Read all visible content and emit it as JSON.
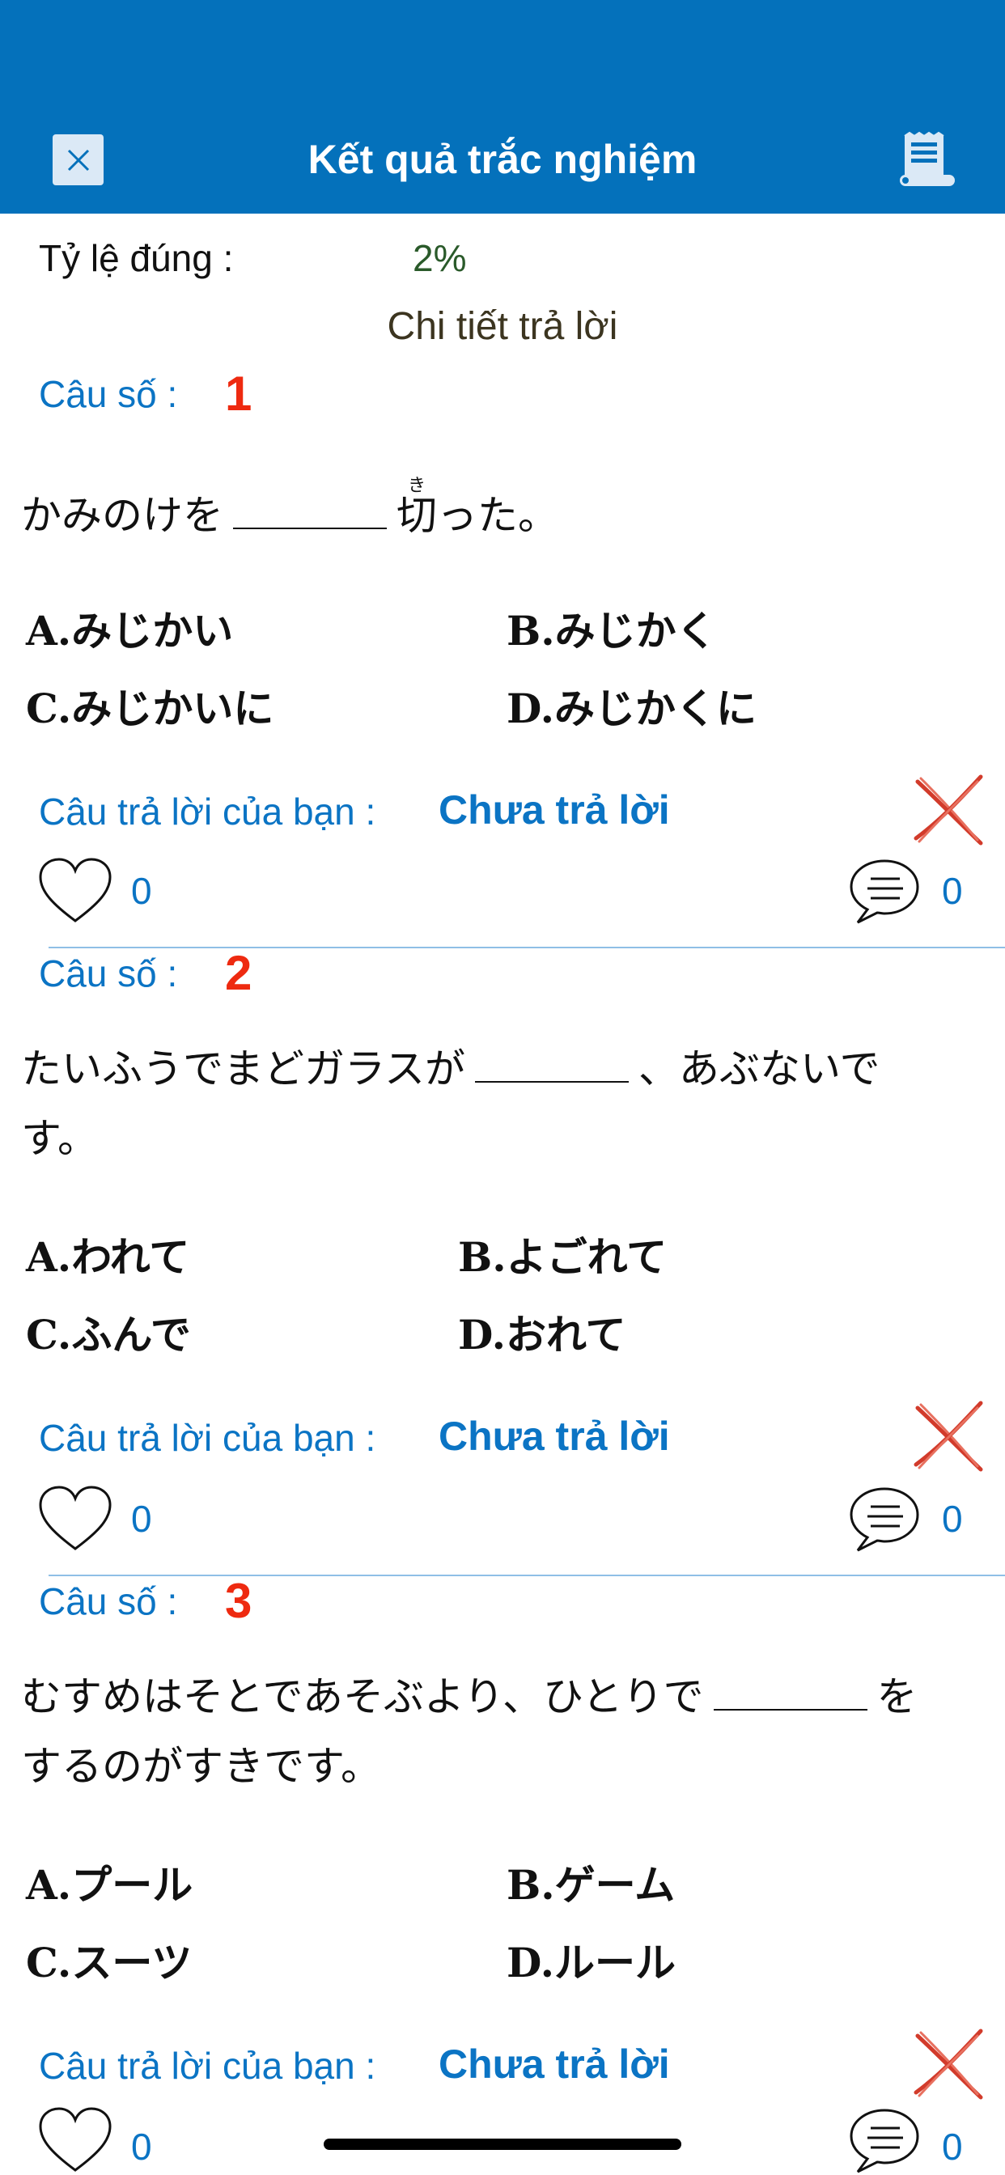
{
  "header": {
    "title": "Kết quả trắc nghiệm"
  },
  "summary": {
    "rate_label": "Tỷ lệ đúng :",
    "rate_value": "2%",
    "detail_title": "Chi tiết trả lời"
  },
  "questions": [
    {
      "label": "Câu số :",
      "number": "1",
      "text_before": "かみのけを",
      "text_after_kanji": "切",
      "furigana": "き",
      "text_tail": "った。",
      "options": [
        "A.みじかい",
        "B.みじかく",
        "C.みじかいに",
        "D.みじかくに"
      ],
      "answer_label": "Câu trả lời của bạn :",
      "answer_value": "Chưa trả lời",
      "likes": "0",
      "comments": "0"
    },
    {
      "label": "Câu số :",
      "number": "2",
      "text_before": "たいふうでまどガラスが",
      "text_after": "、あぶないで",
      "text_line2": "す。",
      "options": [
        "A.われて",
        "B.よごれて",
        "C.ふんで",
        "D.おれて"
      ],
      "answer_label": "Câu trả lời của bạn :",
      "answer_value": "Chưa trả lời",
      "likes": "0",
      "comments": "0"
    },
    {
      "label": "Câu số :",
      "number": "3",
      "text_before": "むすめはそとであそぶより、ひとりで",
      "text_after": "を",
      "text_line2": "するのがすきです。",
      "options": [
        "A.プール",
        "B.ゲーム",
        "C.スーツ",
        "D.ルール"
      ],
      "answer_label": "Câu trả lời của bạn :",
      "answer_value": "Chưa trả lời",
      "likes": "0",
      "comments": "0"
    }
  ],
  "icons": {
    "close": "close-icon",
    "scroll": "scroll-icon",
    "wrong": "wrong-x-icon",
    "heart": "heart-icon",
    "comment": "comment-icon"
  },
  "colors": {
    "header_bg": "#0471bb",
    "accent_blue": "#0b74c4",
    "number_red": "#ee2a10",
    "rate_green": "#2a5a2a"
  }
}
